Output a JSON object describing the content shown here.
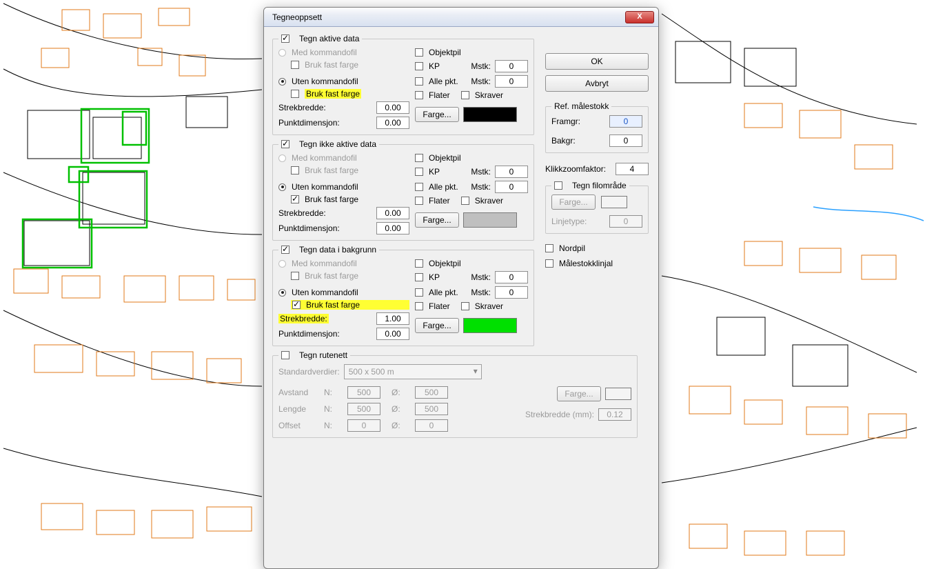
{
  "dialog": {
    "title": "Tegneoppsett",
    "ok": "OK",
    "cancel": "Avbryt",
    "close": "X"
  },
  "sections": {
    "active": {
      "legend": "Tegn aktive data",
      "legend_checked": true,
      "med_kommandofil": "Med kommandofil",
      "bruk_fast_farge_1": "Bruk fast farge",
      "uten_kommandofil": "Uten kommandofil",
      "bruk_fast_farge_2": "Bruk fast farge",
      "bruk_fast_farge_2_checked": false,
      "bruk_fast_farge_2_highlight": true,
      "strekbredde_label": "Strekbredde:",
      "strekbredde": "0.00",
      "punkt_label": "Punktdimensjon:",
      "punkt": "0.00",
      "objektpil": "Objektpil",
      "kp": "KP",
      "kp_mstk_label": "Mstk:",
      "kp_mstk": "0",
      "allepkt": "Alle pkt.",
      "allepkt_mstk_label": "Mstk:",
      "allepkt_mstk": "0",
      "flater": "Flater",
      "skraver": "Skraver",
      "farge_btn": "Farge...",
      "farge_color": "#000000"
    },
    "inactive": {
      "legend": "Tegn ikke aktive data",
      "legend_checked": true,
      "med_kommandofil": "Med kommandofil",
      "bruk_fast_farge_1": "Bruk fast farge",
      "uten_kommandofil": "Uten kommandofil",
      "bruk_fast_farge_2": "Bruk fast farge",
      "bruk_fast_farge_2_checked": true,
      "strekbredde_label": "Strekbredde:",
      "strekbredde": "0.00",
      "punkt_label": "Punktdimensjon:",
      "punkt": "0.00",
      "objektpil": "Objektpil",
      "kp": "KP",
      "kp_mstk_label": "Mstk:",
      "kp_mstk": "0",
      "allepkt": "Alle pkt.",
      "allepkt_mstk_label": "Mstk:",
      "allepkt_mstk": "0",
      "flater": "Flater",
      "skraver": "Skraver",
      "farge_btn": "Farge...",
      "farge_color": "#bfbfbf"
    },
    "background": {
      "legend": "Tegn data i bakgrunn",
      "legend_checked": true,
      "med_kommandofil": "Med kommandofil",
      "bruk_fast_farge_1": "Bruk fast farge",
      "uten_kommandofil": "Uten kommandofil",
      "bruk_fast_farge_2": "Bruk fast farge",
      "bruk_fast_farge_2_checked": true,
      "bruk_fast_farge_2_highlight": true,
      "strekbredde_label": "Strekbredde:",
      "strekbredde_label_highlight": true,
      "strekbredde": "1.00",
      "punkt_label": "Punktdimensjon:",
      "punkt": "0.00",
      "objektpil": "Objektpil",
      "kp": "KP",
      "kp_mstk_label": "Mstk:",
      "kp_mstk": "0",
      "allepkt": "Alle pkt.",
      "allepkt_mstk_label": "Mstk:",
      "allepkt_mstk": "0",
      "flater": "Flater",
      "skraver": "Skraver",
      "farge_btn": "Farge...",
      "farge_color": "#00e000"
    },
    "grid": {
      "legend": "Tegn rutenett",
      "legend_checked": false,
      "std_label": "Standardverdier:",
      "std_value": "500 x 500 m",
      "avstand": "Avstand",
      "lengde": "Lengde",
      "offset": "Offset",
      "n": "N:",
      "o": "Ø:",
      "avstand_n": "500",
      "avstand_o": "500",
      "lengde_n": "500",
      "lengde_o": "500",
      "offset_n": "0",
      "offset_o": "0",
      "farge_btn": "Farge...",
      "strekbredde_label": "Strekbredde (mm):",
      "strekbredde": "0.12"
    }
  },
  "right": {
    "ref_scale": {
      "legend": "Ref. målestokk",
      "framgr_label": "Framgr:",
      "framgr": "0",
      "bakgr_label": "Bakgr:",
      "bakgr": "0"
    },
    "clickzoom_label": "Klikkzoomfaktor:",
    "clickzoom": "4",
    "filomrade": {
      "legend": "Tegn filområde",
      "legend_checked": false,
      "farge_btn": "Farge...",
      "linjetype_label": "Linjetype:",
      "linjetype": "0"
    },
    "nordpil": "Nordpil",
    "malestokklinjal": "Målestokklinjal"
  }
}
